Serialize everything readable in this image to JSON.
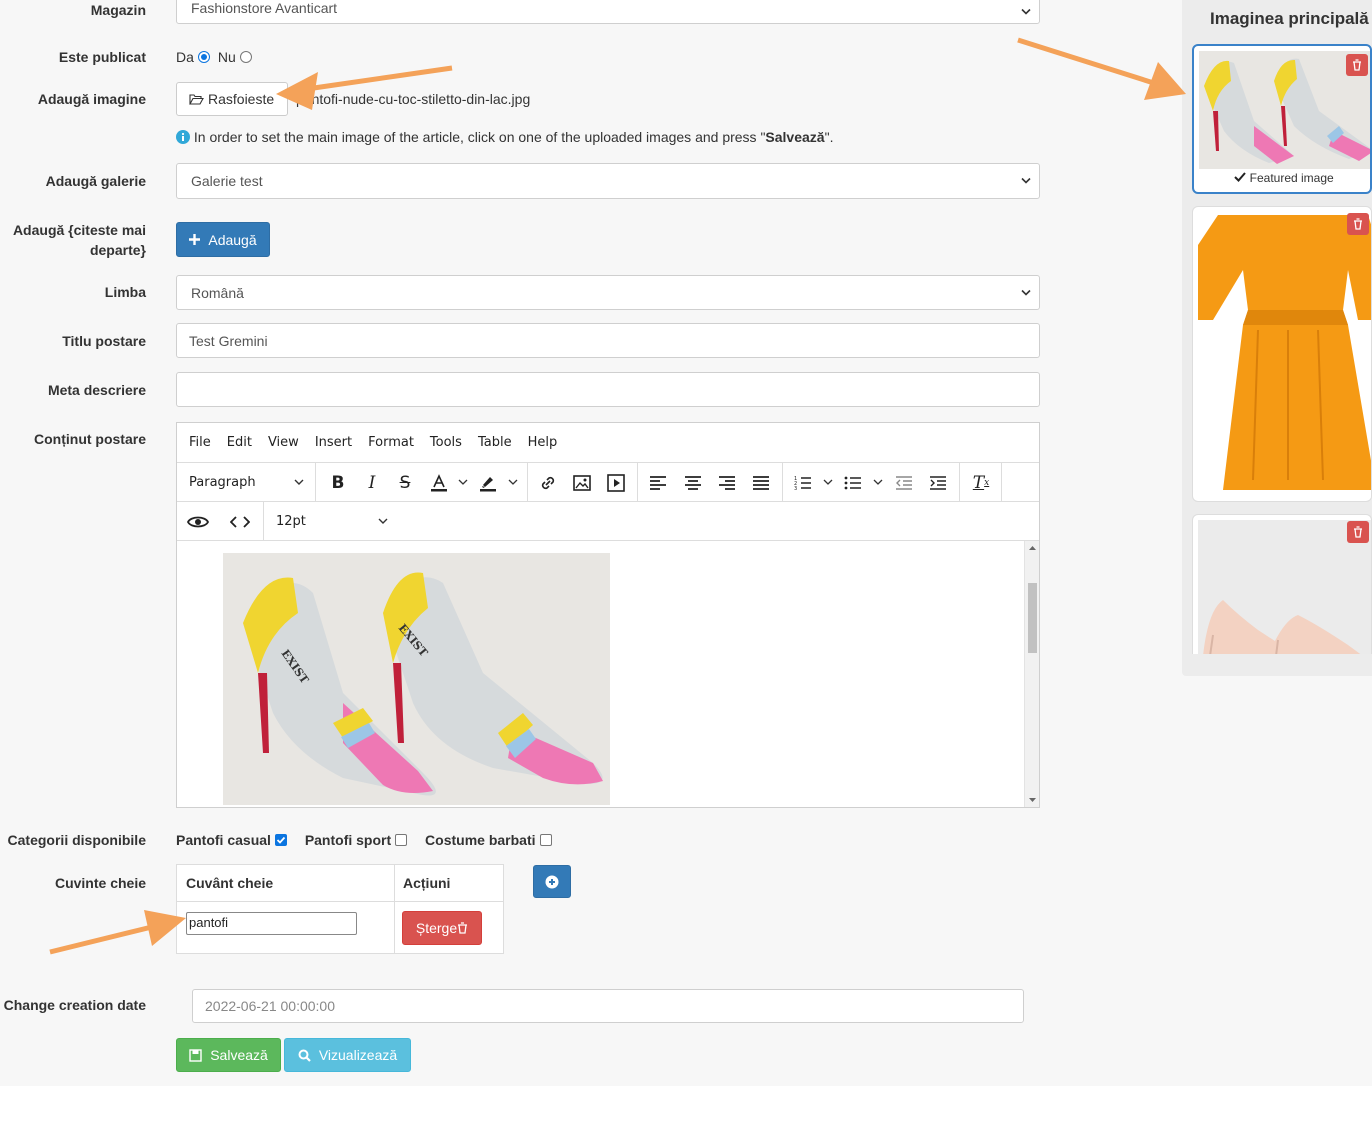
{
  "form": {
    "magazin": {
      "label": "Magazin",
      "value": "Fashionstore Avanticart"
    },
    "publicat": {
      "label": "Este publicat",
      "yes": "Da",
      "no": "Nu",
      "selected": "Da"
    },
    "imagine": {
      "label": "Adaugă imagine",
      "browse": "Rasfoieste",
      "filename": "pantofi-nude-cu-toc-stiletto-din-lac.jpg",
      "hint_pre": "In order to set the main image of the article, click on one of the uploaded images and press \"",
      "hint_bold": "Salvează",
      "hint_post": "\"."
    },
    "galerie": {
      "label": "Adaugă galerie",
      "value": "Galerie test"
    },
    "citeste": {
      "label_1": "Adaugă {citeste mai",
      "label_2": "departe}",
      "button": "Adaugă"
    },
    "limba": {
      "label": "Limba",
      "value": "Română"
    },
    "titlu": {
      "label": "Titlu postare",
      "value": "Test Gremini"
    },
    "meta": {
      "label": "Meta descriere",
      "value": ""
    },
    "continut": {
      "label": "Conținut postare"
    },
    "categorii": {
      "label": "Categorii disponibile",
      "items": [
        {
          "name": "Pantofi casual",
          "checked": true
        },
        {
          "name": "Pantofi sport",
          "checked": false
        },
        {
          "name": "Costume barbati",
          "checked": false
        }
      ]
    },
    "cuvinte": {
      "label": "Cuvinte cheie",
      "col_word": "Cuvânt cheie",
      "col_actions": "Acțiuni",
      "rows": [
        {
          "value": "pantofi",
          "delete": "Șterge"
        }
      ]
    },
    "creation": {
      "label": "Change creation date",
      "value": "2022-06-21 00:00:00"
    },
    "save": "Salvează",
    "preview": "Vizualizează"
  },
  "editor": {
    "menu": [
      "File",
      "Edit",
      "View",
      "Insert",
      "Format",
      "Tools",
      "Table",
      "Help"
    ],
    "block_format": "Paragraph",
    "font_size": "12pt",
    "image_brand": "EXIST"
  },
  "sidebar": {
    "title": "Imaginea principală",
    "featured_label": "Featured image"
  },
  "colors": {
    "accent": "#0b75e0",
    "arrow": "#f4a259",
    "primary": "#337ab7",
    "danger": "#d9534f",
    "success": "#5cb85c",
    "info": "#5bc0de"
  }
}
